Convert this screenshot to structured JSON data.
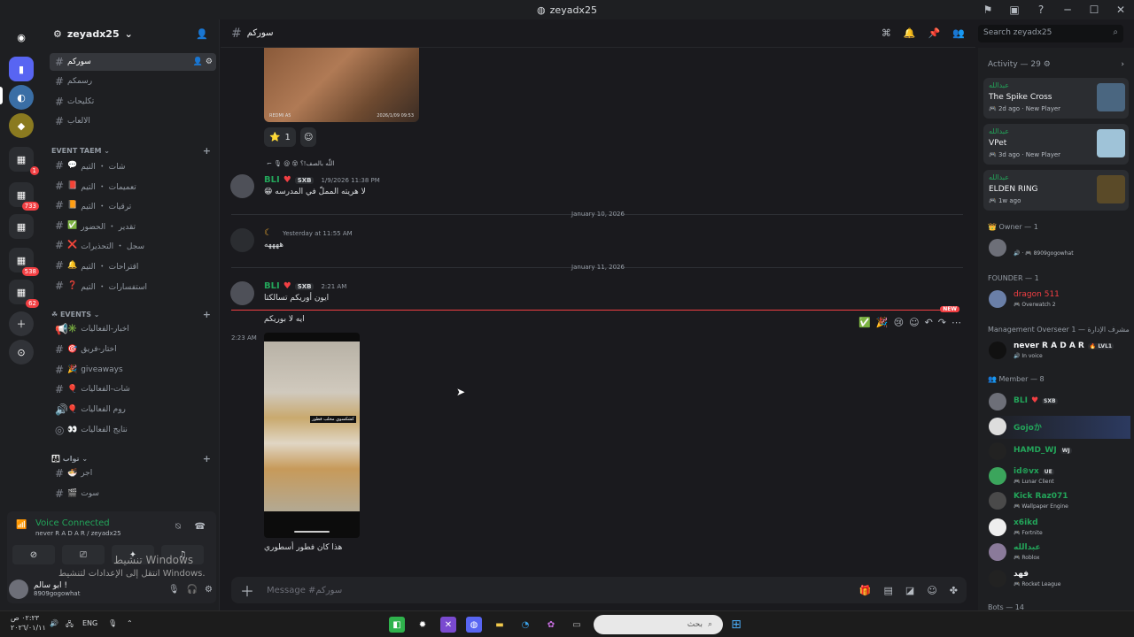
{
  "window": {
    "title": "zeyadx25"
  },
  "servers": [
    {
      "badge": ""
    },
    {
      "badge": ""
    },
    {
      "badge": ""
    },
    {
      "badge": "1"
    },
    {
      "badge": "733"
    },
    {
      "badge": "538"
    },
    {
      "badge": "62"
    }
  ],
  "guild": {
    "name": "zeyadx25"
  },
  "channels": {
    "top": [
      {
        "name": "سورکم",
        "emoji": ""
      },
      {
        "name": "رسمكم",
        "emoji": ""
      },
      {
        "name": "تكليحات",
        "emoji": ""
      },
      {
        "name": "الالعاب",
        "emoji": ""
      }
    ],
    "cat1": "EVENT TAEM",
    "event_team": [
      {
        "name": "شات ・ التيم",
        "emoji": "💬"
      },
      {
        "name": "تعميمات ・ التيم",
        "emoji": "📕"
      },
      {
        "name": "ترقيات ・ التيم",
        "emoji": "📙"
      },
      {
        "name": "تقدير ・ الحضور",
        "emoji": "✅"
      },
      {
        "name": "سجل ・ التحذيرات",
        "emoji": "❌"
      },
      {
        "name": "اقتراحات ・ التيم",
        "emoji": "🔔"
      },
      {
        "name": "استفسارات ・ التيم",
        "emoji": "❓"
      }
    ],
    "cat2": "EVENTS",
    "events": [
      {
        "name": "اخبار-الفعاليات",
        "emoji": "✳️"
      },
      {
        "name": "اختار-فريق",
        "emoji": "🎯"
      },
      {
        "name": "giveaways",
        "emoji": "🎉"
      },
      {
        "name": "شات-الفعاليات",
        "emoji": "🎈"
      },
      {
        "name": "روم الفعاليات",
        "emoji": "🎈"
      },
      {
        "name": "نتايج الفعاليات",
        "emoji": "👀"
      }
    ],
    "cat3": "تواب",
    "tawab": [
      {
        "name": "اجر",
        "emoji": "🍜"
      },
      {
        "name": "سوت",
        "emoji": "🎬"
      }
    ]
  },
  "voice": {
    "title": "Voice Connected",
    "sub": "never R A D A R / zeyadx25"
  },
  "winact": {
    "line1": "تنشيط Windows",
    "line2": "انتقل إلى الإعدادات لتنشيط Windows."
  },
  "user": {
    "name": "ابو سالم !",
    "tag": "8909gogowhat"
  },
  "channel": {
    "name": "سورکم"
  },
  "search": {
    "placeholder": "Search zeyadx25"
  },
  "messages": {
    "img1_label": "REDMI A5",
    "img1_date": "2026/1/09 09:53",
    "react_count": "1",
    "reply_text": "اللّٰه بالصف!؟",
    "m1": {
      "author": "BLI",
      "server_tag": "SXB",
      "time": "1/9/2026 11:38 PM",
      "text": "لا هريته المملّ في المدرسه"
    },
    "date1": "January 10, 2026",
    "m2": {
      "author": "",
      "time": "Yesterday at 11:55 AM",
      "text": "ههههه"
    },
    "date2": "January 11, 2026",
    "m3": {
      "author": "BLI",
      "server_tag": "SXB",
      "time": "2:21 AM",
      "text": "ايون أوريكم تسالكتا"
    },
    "new_label": "NEW",
    "m4_text": "ايه لا بوريكم",
    "m5_time": "2:23 AM",
    "phone_caption": "كشكسوي مخلب فطور",
    "m5_text": "هذا كان فطور أسطوري"
  },
  "composer": {
    "placeholder": "Message #سورکم"
  },
  "members": {
    "activity_header": "Activity — 29",
    "activities": [
      {
        "who": "عبدالله",
        "game": "The Spike Cross",
        "meta": "2d ago",
        "badge": "New Player"
      },
      {
        "who": "عبدالله",
        "game": "VPet",
        "meta": "3d ago",
        "badge": "New Player"
      },
      {
        "who": "عبدالله",
        "game": "ELDEN RING",
        "meta": "1w ago",
        "badge": ""
      }
    ],
    "owner_hdr": "Owner — 1",
    "owner": {
      "name": "",
      "status": "8909gogowhat"
    },
    "founder_hdr": "FOUNDER — 1",
    "founder": {
      "name": "dragon 511",
      "status": "Overwatch 2"
    },
    "mgmt_hdr": "Management Overseer مشرف الإدارة — 1",
    "mgmt": {
      "name": "never R A D A R",
      "tag": "LVL1",
      "status": "In voice"
    },
    "member_hdr": "Member — 8",
    "list": [
      {
        "name": "BLI",
        "tag": "SXB",
        "status": ""
      },
      {
        "name": "Gojoか",
        "tag": "",
        "status": ""
      },
      {
        "name": "HAMD_WJ",
        "tag": "WJ",
        "status": ""
      },
      {
        "name": "id⊗vx",
        "tag": "UE",
        "status": "Lunar Client"
      },
      {
        "name": "Kick Raz071",
        "tag": "",
        "status": "Wallpaper Engine"
      },
      {
        "name": "x6ikd",
        "tag": "",
        "status": "Fortnite"
      },
      {
        "name": "عبدالله",
        "tag": "",
        "status": "Roblox"
      },
      {
        "name": "فهد",
        "tag": "",
        "status": "Rocket League"
      }
    ],
    "bots_hdr": "Bots — 14"
  },
  "taskbar": {
    "search_placeholder": "بحث",
    "lang": "ENG",
    "time": "٠٢:٢٣ ص",
    "date": "٢٠٢٦/٠١/١١"
  },
  "colors": {
    "green": "#23a55a",
    "red": "#f23f43",
    "founder": "#f23f43"
  }
}
